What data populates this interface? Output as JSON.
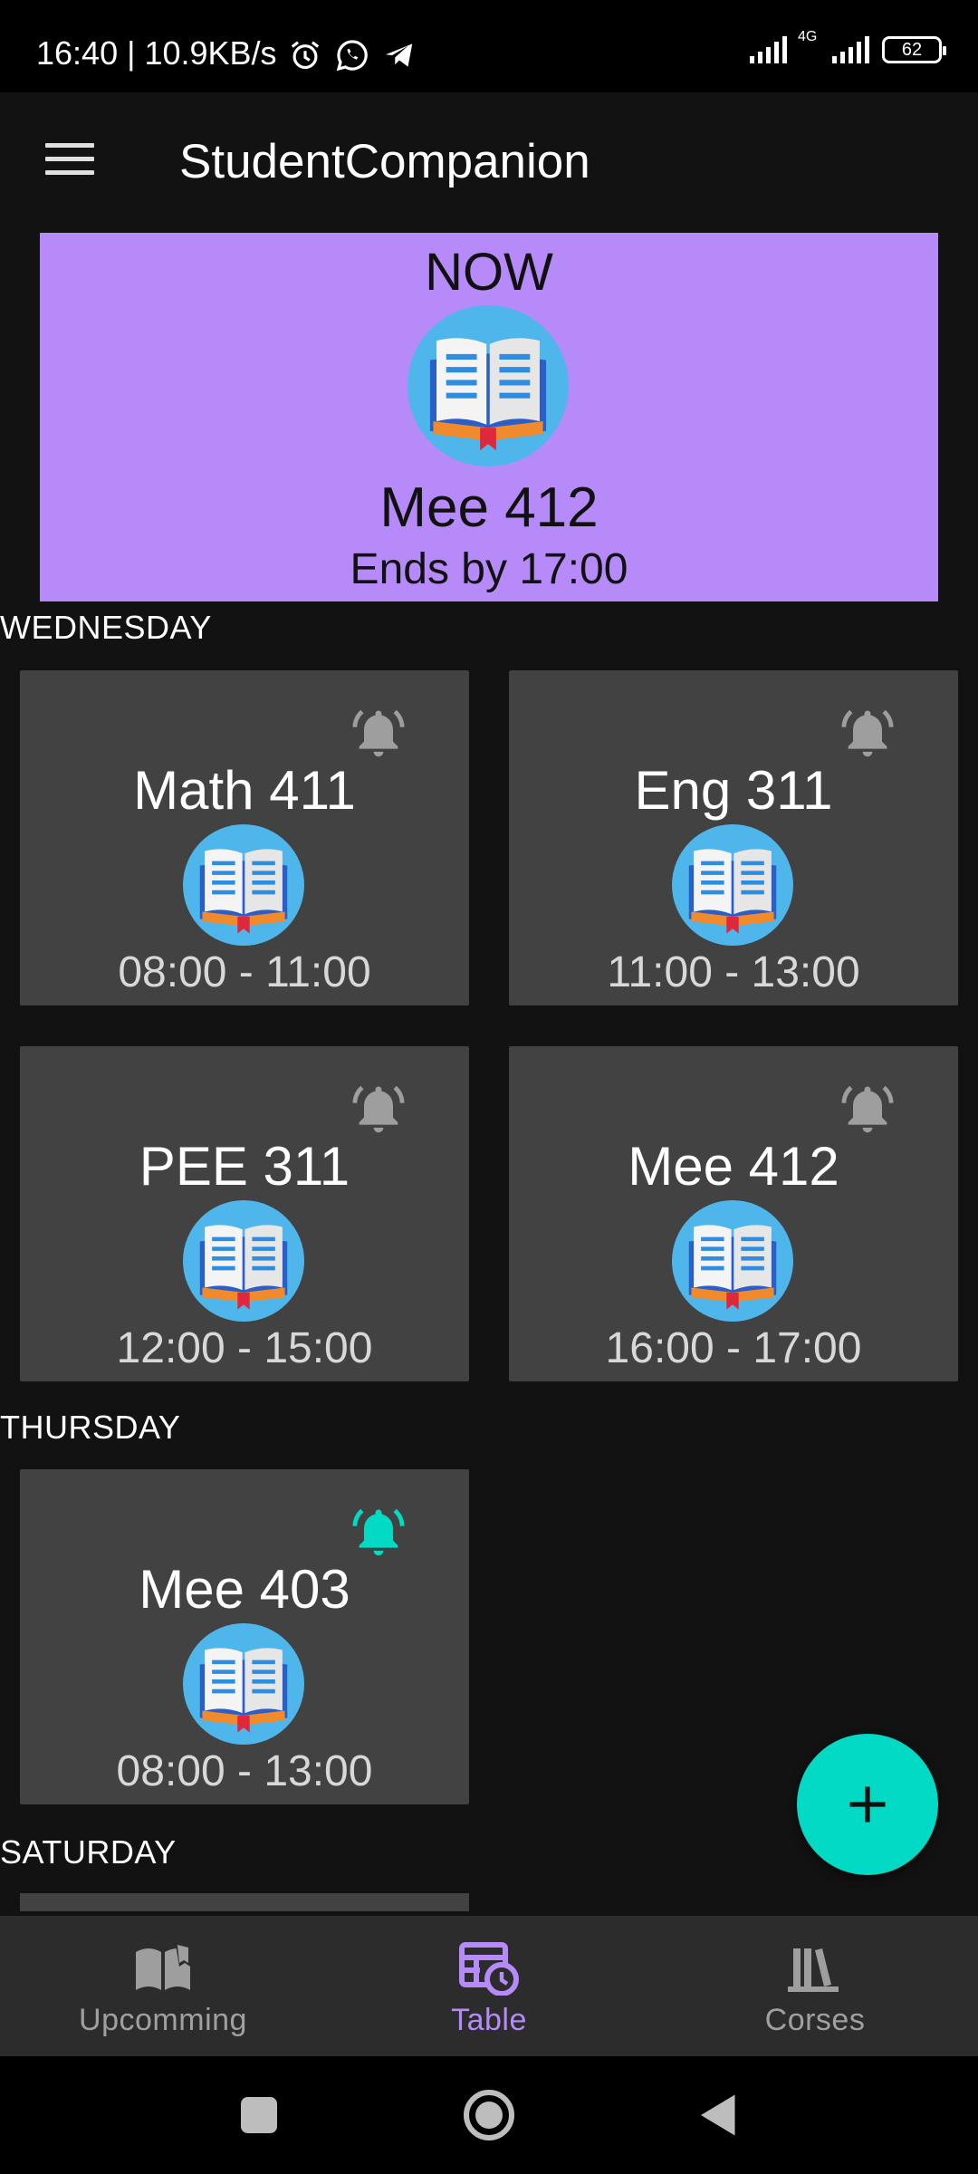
{
  "status_bar": {
    "time_speed": "16:40 | 10.9KB/s",
    "network": "4G",
    "battery": "62"
  },
  "app_bar": {
    "title": "StudentCompanion"
  },
  "now_card": {
    "label": "NOW",
    "course": "Mee 412",
    "ends": "Ends by 17:00"
  },
  "days": [
    {
      "label": "WEDNESDAY",
      "classes": [
        {
          "name": "Math 411",
          "time": "08:00 - 11:00",
          "bell": "inactive"
        },
        {
          "name": "Eng 311",
          "time": "11:00 - 13:00",
          "bell": "inactive"
        },
        {
          "name": "PEE 311",
          "time": "12:00 - 15:00",
          "bell": "inactive"
        },
        {
          "name": "Mee 412",
          "time": "16:00 - 17:00",
          "bell": "inactive"
        }
      ]
    },
    {
      "label": "THURSDAY",
      "classes": [
        {
          "name": "Mee 403",
          "time": "08:00 - 13:00",
          "bell": "active"
        }
      ]
    },
    {
      "label": "SATURDAY",
      "classes": []
    }
  ],
  "bottom_nav": {
    "items": [
      {
        "label": "Upcomming",
        "icon": "open-book-icon",
        "active": false
      },
      {
        "label": "Table",
        "icon": "calendar-clock-icon",
        "active": true
      },
      {
        "label": "Corses",
        "icon": "books-icon",
        "active": false
      }
    ]
  },
  "colors": {
    "accent": "#b68af8",
    "fab": "#03dac5",
    "bell_active": "#03dac5",
    "bell_inactive": "#9e9e9e",
    "card": "#424242",
    "background": "#121212"
  }
}
